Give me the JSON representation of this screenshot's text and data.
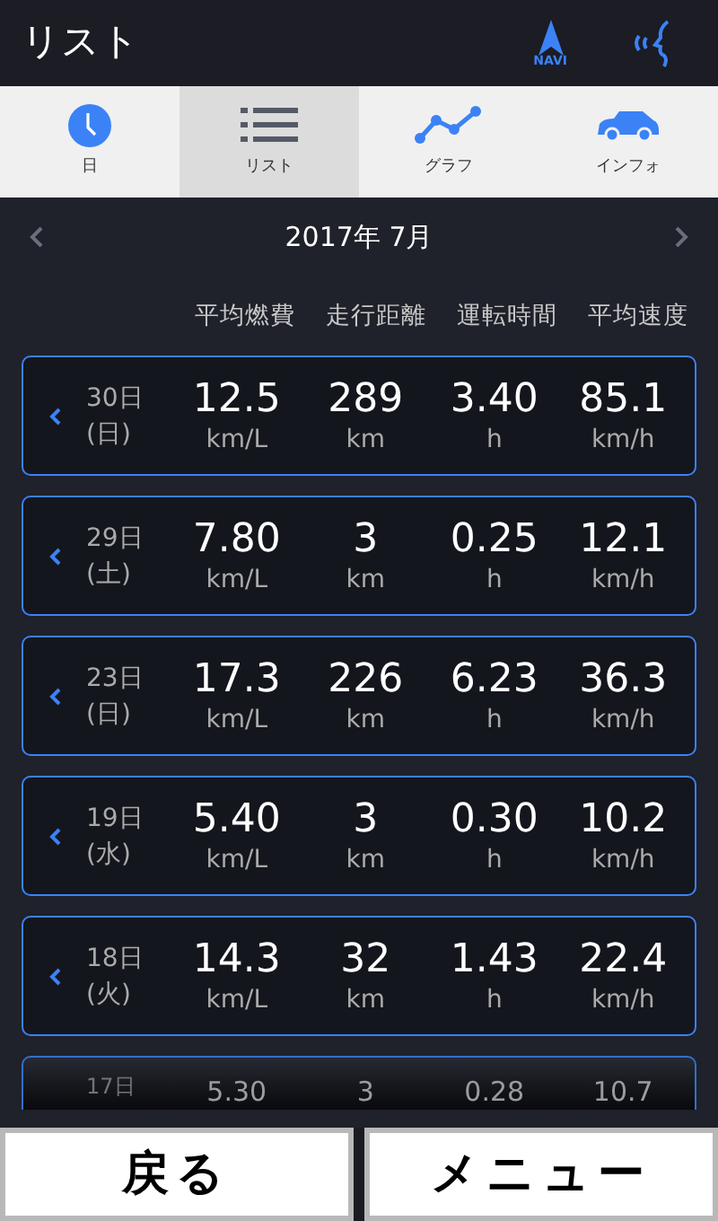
{
  "header": {
    "title": "リスト",
    "navi_label": "NAVI"
  },
  "tabs": [
    {
      "label": "日",
      "kind": "clock",
      "selected": false
    },
    {
      "label": "リスト",
      "kind": "list",
      "selected": true
    },
    {
      "label": "グラフ",
      "kind": "graph",
      "selected": false
    },
    {
      "label": "インフォ",
      "kind": "car",
      "selected": false
    }
  ],
  "month": {
    "label": "2017年 7月"
  },
  "columns": [
    "平均燃費",
    "走行距離",
    "運転時間",
    "平均速度"
  ],
  "rows": [
    {
      "day": "30日",
      "weekday": "(日)",
      "values": [
        "12.5",
        "289",
        "3.40",
        "85.1"
      ],
      "units": [
        "km/L",
        "km",
        "h",
        "km/h"
      ]
    },
    {
      "day": "29日",
      "weekday": "(土)",
      "values": [
        "7.80",
        "3",
        "0.25",
        "12.1"
      ],
      "units": [
        "km/L",
        "km",
        "h",
        "km/h"
      ]
    },
    {
      "day": "23日",
      "weekday": "(日)",
      "values": [
        "17.3",
        "226",
        "6.23",
        "36.3"
      ],
      "units": [
        "km/L",
        "km",
        "h",
        "km/h"
      ]
    },
    {
      "day": "19日",
      "weekday": "(水)",
      "values": [
        "5.40",
        "3",
        "0.30",
        "10.2"
      ],
      "units": [
        "km/L",
        "km",
        "h",
        "km/h"
      ]
    },
    {
      "day": "18日",
      "weekday": "(火)",
      "values": [
        "14.3",
        "32",
        "1.43",
        "22.4"
      ],
      "units": [
        "km/L",
        "km",
        "h",
        "km/h"
      ]
    }
  ],
  "partial_row": {
    "day": "17日",
    "values": [
      "5.30",
      "3",
      "0.28",
      "10.7"
    ]
  },
  "buttons": [
    "戻る",
    "メニュー"
  ]
}
